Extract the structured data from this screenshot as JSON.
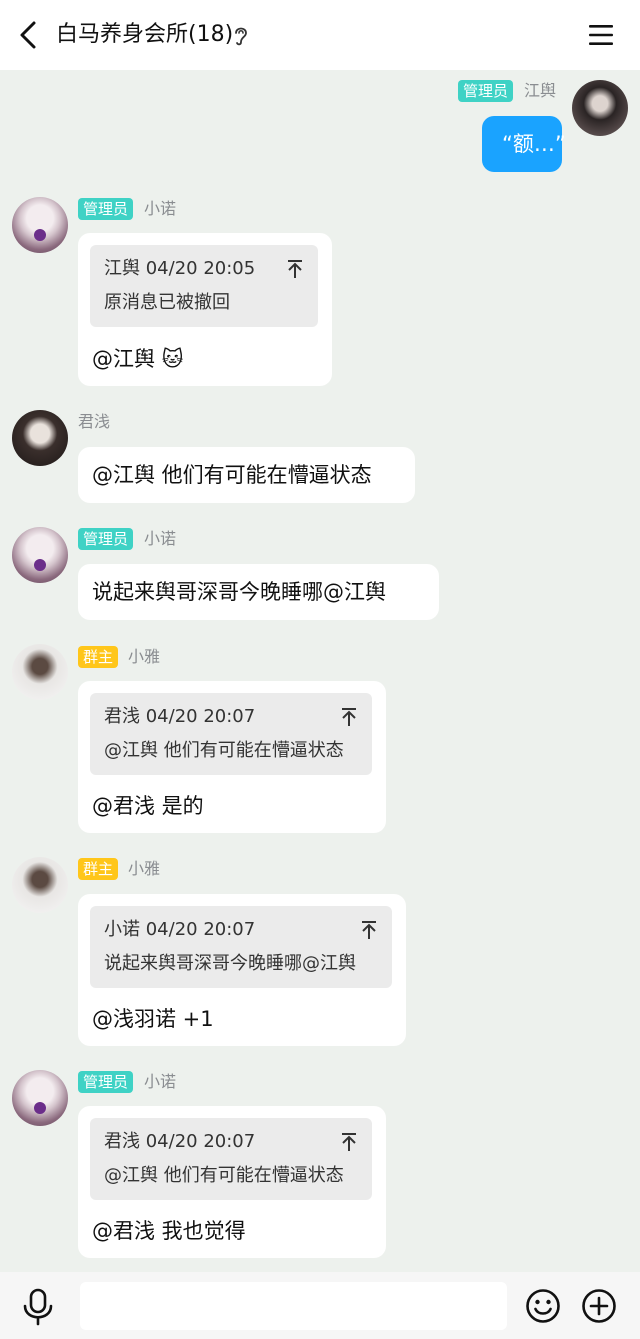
{
  "header": {
    "title": "白马养身会所(18)",
    "back_icon": "chevron-left-icon",
    "ear_icon": "ear-icon",
    "menu_icon": "hamburger-menu-icon"
  },
  "messages": [
    {
      "sender": "江舆",
      "role": "管理员",
      "text": "“额…”",
      "mine": true
    },
    {
      "sender": "小诺",
      "role": "管理员",
      "quote": {
        "author": "江舆",
        "time": "04/20 20:05",
        "text": "原消息已被撤回"
      },
      "text": "@江舆 🐱"
    },
    {
      "sender": "君浅",
      "role": "",
      "text": "@江舆 他们有可能在懵逼状态"
    },
    {
      "sender": "小诺",
      "role": "管理员",
      "text": "说起来舆哥深哥今晚睡哪@江舆"
    },
    {
      "sender": "小雅",
      "role": "群主",
      "quote": {
        "author": "君浅",
        "time": "04/20 20:07",
        "text": "@江舆 他们有可能在懵逼状态"
      },
      "text": "@君浅 是的"
    },
    {
      "sender": "小雅",
      "role": "群主",
      "quote": {
        "author": "小诺",
        "time": "04/20 20:07",
        "text": "说起来舆哥深哥今晚睡哪@江舆"
      },
      "text": "@浅羽诺 +1"
    },
    {
      "sender": "小诺",
      "role": "管理员",
      "quote": {
        "author": "君浅",
        "time": "04/20 20:07",
        "text": "@江舆 他们有可能在懵逼状态"
      },
      "text": "@君浅 我也觉得"
    }
  ],
  "input": {
    "value": "",
    "placeholder": ""
  },
  "toolbar": {
    "mic_icon": "microphone-icon",
    "emoji_icon": "smiley-icon",
    "plus_icon": "plus-circle-icon"
  },
  "colors": {
    "admin_badge": "#3fd2c5",
    "owner_badge": "#ffc61a",
    "my_bubble": "#1aa3ff",
    "background": "#edf1ed"
  }
}
